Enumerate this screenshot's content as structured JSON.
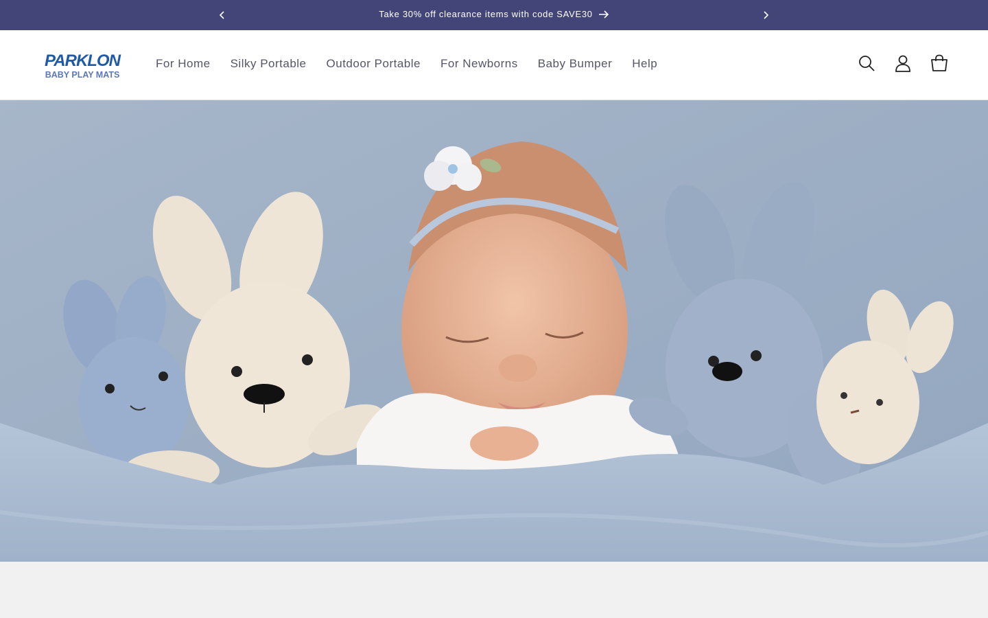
{
  "announcement": {
    "text": "Take 30% off clearance items with code SAVE30"
  },
  "brand": {
    "name": "PARKLON",
    "tagline": "BABY PLAY MATS",
    "primary_color": "#1f5aa8",
    "bar_color": "#434478"
  },
  "nav": {
    "items": [
      {
        "label": "For Home"
      },
      {
        "label": "Silky Portable"
      },
      {
        "label": "Outdoor Portable"
      },
      {
        "label": "For Newborns"
      },
      {
        "label": "Baby Bumper"
      },
      {
        "label": "Help"
      }
    ]
  },
  "header_icons": [
    "search-icon",
    "account-icon",
    "cart-icon"
  ],
  "hero": {
    "image": "newborn-with-knitted-bunnies"
  }
}
